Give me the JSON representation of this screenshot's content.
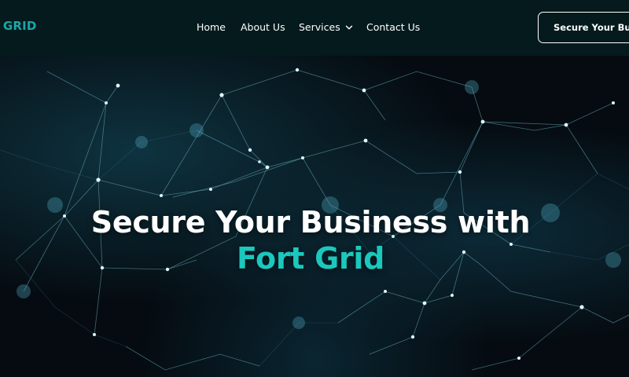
{
  "brand": {
    "logo_text": "T GRID"
  },
  "nav": {
    "items": [
      {
        "label": "Home"
      },
      {
        "label": "About Us"
      },
      {
        "label": "Services"
      },
      {
        "label": "Contact Us"
      }
    ],
    "cta_label": "Secure Your Business"
  },
  "hero": {
    "title_line1": "Secure Your Business with",
    "title_line2": "Fort Grid"
  },
  "colors": {
    "nav_bg": "#041a1d",
    "accent": "#1bc8bd",
    "logo": "#1aa7a8"
  },
  "icons": {
    "services_dropdown": "chevron-down-icon"
  }
}
